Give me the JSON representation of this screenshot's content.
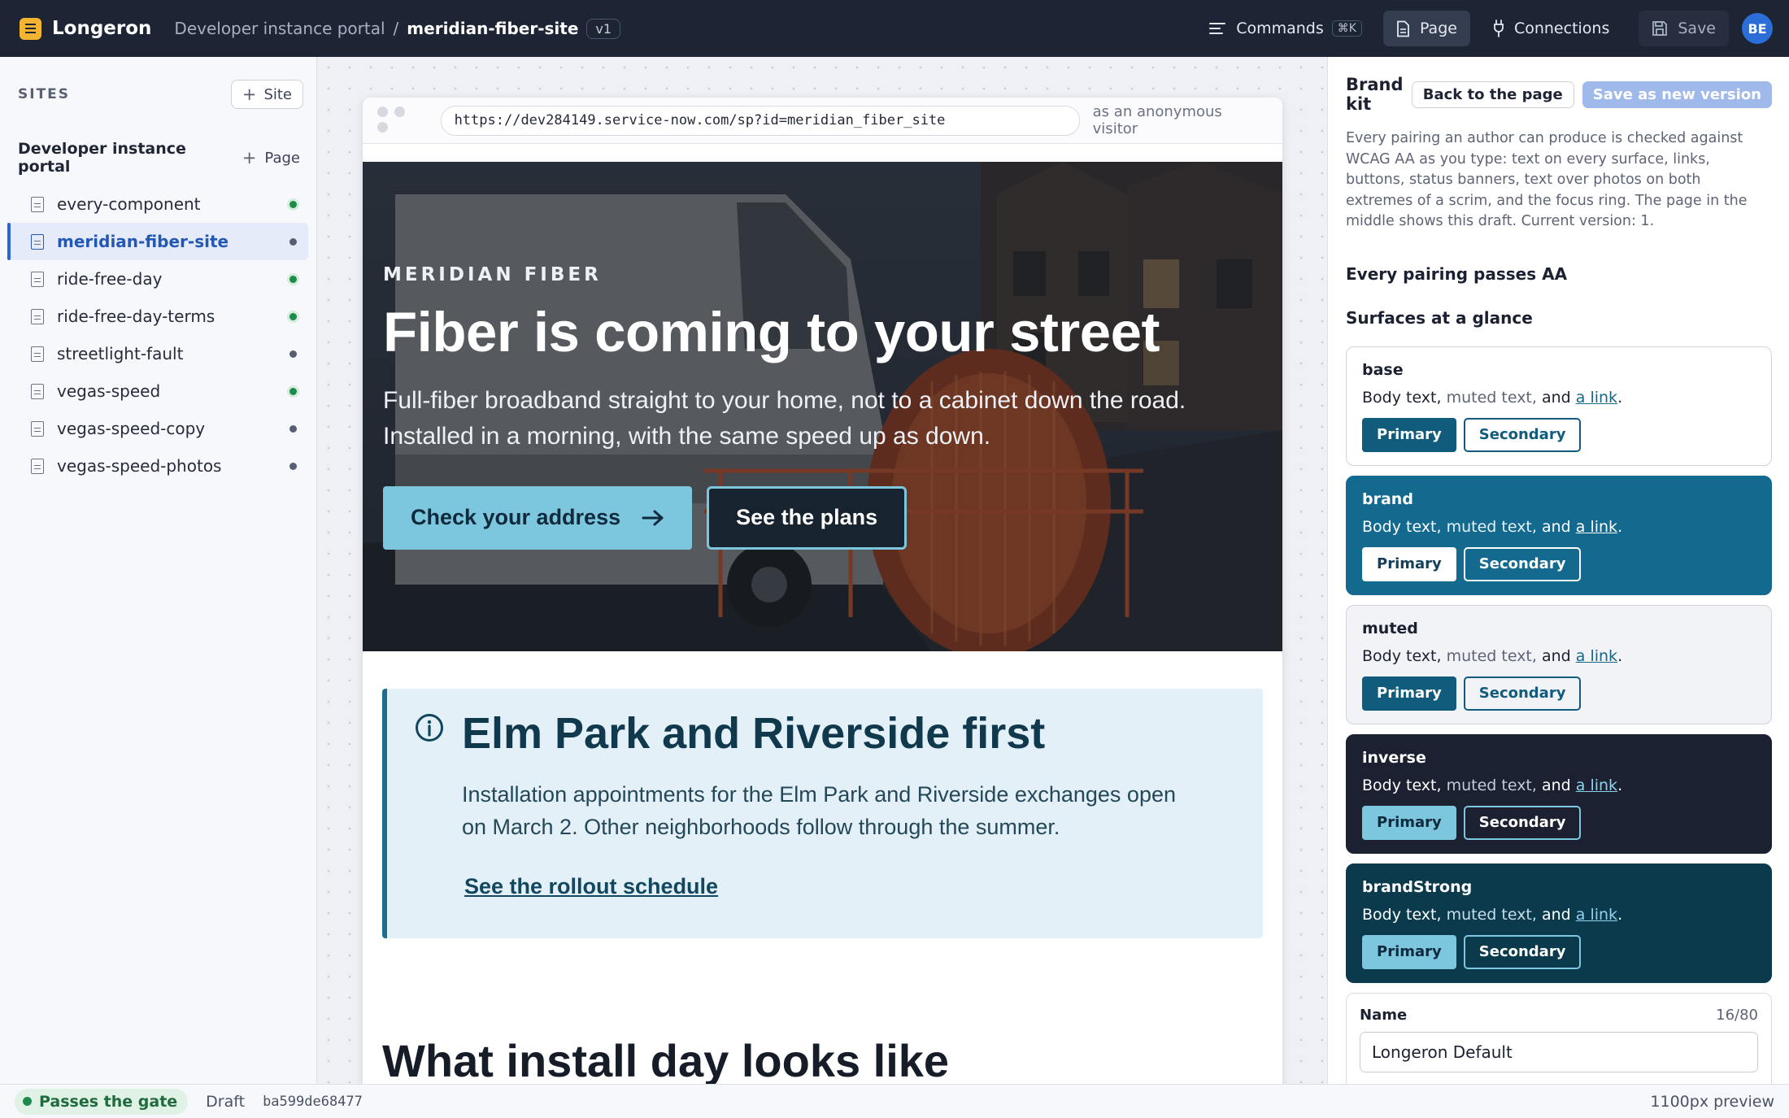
{
  "app": {
    "name": "Longeron",
    "logo_icon": "menu-logo-icon"
  },
  "breadcrumb": {
    "portal": "Developer instance portal",
    "separator": "/",
    "site": "meridian-fiber-site",
    "version": "v1"
  },
  "toolbar": {
    "commands": "Commands",
    "commands_shortcut": "⌘K",
    "page": "Page",
    "connections": "Connections",
    "save": "Save",
    "avatar_initials": "BE"
  },
  "sidebar": {
    "sites_heading": "SITES",
    "add_site": "Site",
    "portal_title": "Developer instance portal",
    "add_page": "Page",
    "items": [
      {
        "label": "every-component",
        "status": "green"
      },
      {
        "label": "meridian-fiber-site",
        "status": "gray",
        "active": true
      },
      {
        "label": "ride-free-day",
        "status": "green"
      },
      {
        "label": "ride-free-day-terms",
        "status": "green"
      },
      {
        "label": "streetlight-fault",
        "status": "gray"
      },
      {
        "label": "vegas-speed",
        "status": "green"
      },
      {
        "label": "vegas-speed-copy",
        "status": "gray"
      },
      {
        "label": "vegas-speed-photos",
        "status": "gray"
      }
    ]
  },
  "preview": {
    "url": "https://dev284149.service-now.com/sp?id=meridian_fiber_site",
    "viewer": "as an anonymous visitor",
    "hero": {
      "eyebrow": "MERIDIAN FIBER",
      "title": "Fiber is coming to your street",
      "subtitle": "Full-fiber broadband straight to your home, not to a cabinet down the road. Installed in a morning, with the same speed up as down.",
      "primary_cta": "Check your address",
      "secondary_cta": "See the plans"
    },
    "banner": {
      "title": "Elm Park and Riverside first",
      "text": "Installation appointments for the Elm Park and Riverside exchanges open on March 2. Other neighborhoods follow through the summer.",
      "link": "See the rollout schedule"
    },
    "next_section_title": "What install day looks like"
  },
  "brand_kit": {
    "title": "Brand kit",
    "back_button": "Back to the page",
    "save_new_version": "Save as new version",
    "description": "Every pairing an author can produce is checked against WCAG AA as you type: text on every surface, links, buttons, status banners, text over photos on both extremes of a scrim, and the focus ring. The page in the middle shows this draft. Current version: 1.",
    "pass_status": "Every pairing passes AA",
    "surfaces_heading": "Surfaces at a glance",
    "surfaces": [
      {
        "name": "base",
        "body": "Body text,",
        "muted": "muted text,",
        "and": "and",
        "link": "a link",
        "period": ".",
        "primary": "Primary",
        "secondary": "Secondary"
      },
      {
        "name": "brand",
        "body": "Body text,",
        "muted": "muted text,",
        "and": "and",
        "link": "a link",
        "period": ".",
        "primary": "Primary",
        "secondary": "Secondary"
      },
      {
        "name": "muted",
        "body": "Body text,",
        "muted": "muted text,",
        "and": "and",
        "link": "a link",
        "period": ".",
        "primary": "Primary",
        "secondary": "Secondary"
      },
      {
        "name": "inverse",
        "body": "Body text,",
        "muted": "muted text,",
        "and": "and",
        "link": "a link",
        "period": ".",
        "primary": "Primary",
        "secondary": "Secondary"
      },
      {
        "name": "brandStrong",
        "body": "Body text,",
        "muted": "muted text,",
        "and": "and",
        "link": "a link",
        "period": ".",
        "primary": "Primary",
        "secondary": "Secondary"
      }
    ],
    "name_field": {
      "label": "Name",
      "count": "16/80",
      "value": "Longeron Default"
    }
  },
  "statusbar": {
    "gate": "Passes the gate",
    "state": "Draft",
    "hash": "ba599de68477",
    "preview_width": "1100px preview"
  },
  "colors": {
    "topbar": "#1d2434",
    "accent": "#2a66d0",
    "brand": "#13698e",
    "brand_strong": "#0b3a4d",
    "highlight": "#7cc6de",
    "pass_green": "#1f8a4c"
  }
}
